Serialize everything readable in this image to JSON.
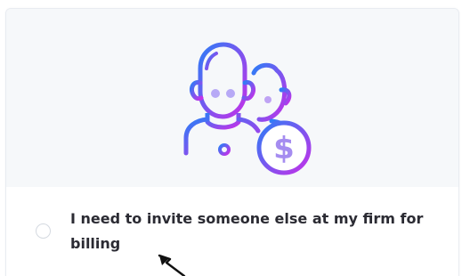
{
  "option": {
    "label": "I need to invite someone else at my firm for billing",
    "selected": false
  },
  "illustration": {
    "icon": "people-billing-icon",
    "currency_symbol": "$",
    "gradient_start": "#2f7cf6",
    "gradient_end": "#c431e8"
  },
  "colors": {
    "illustration_background": "#f6f8fa",
    "label_text": "#2b2b33",
    "radio_border": "#d4d9e0"
  }
}
